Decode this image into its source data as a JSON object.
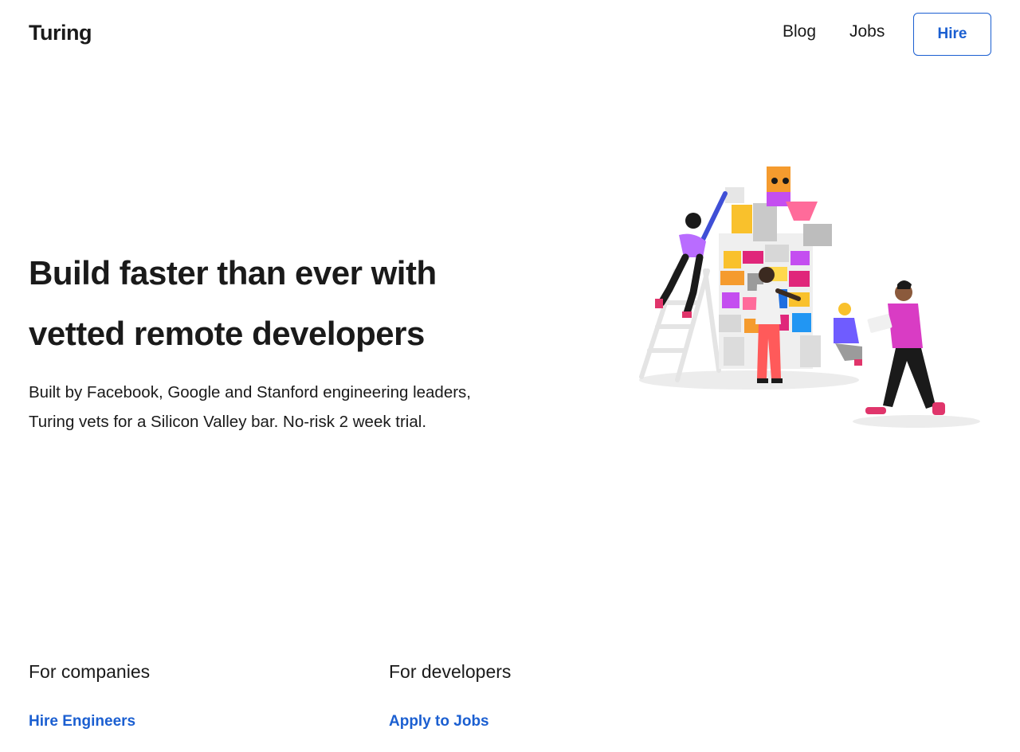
{
  "header": {
    "logo": "Turing",
    "nav": {
      "blog": "Blog",
      "jobs": "Jobs"
    },
    "hire_label": "Hire"
  },
  "hero": {
    "title_lines": [
      "Build faster than ever with",
      "vetted remote developers"
    ],
    "subtitle_lines": [
      "Built by Facebook, Google and Stanford engineering leaders,",
      "Turing vets for a Silicon Valley bar. No-risk 2 week trial."
    ],
    "illustration": "people-building-block-tower-illustration"
  },
  "footer": {
    "companies": {
      "heading": "For companies",
      "link": "Hire Engineers"
    },
    "developers": {
      "heading": "For developers",
      "link": "Apply to Jobs"
    }
  },
  "colors": {
    "accent": "#1b5fd1",
    "text": "#1a1a1a",
    "background": "#ffffff"
  }
}
